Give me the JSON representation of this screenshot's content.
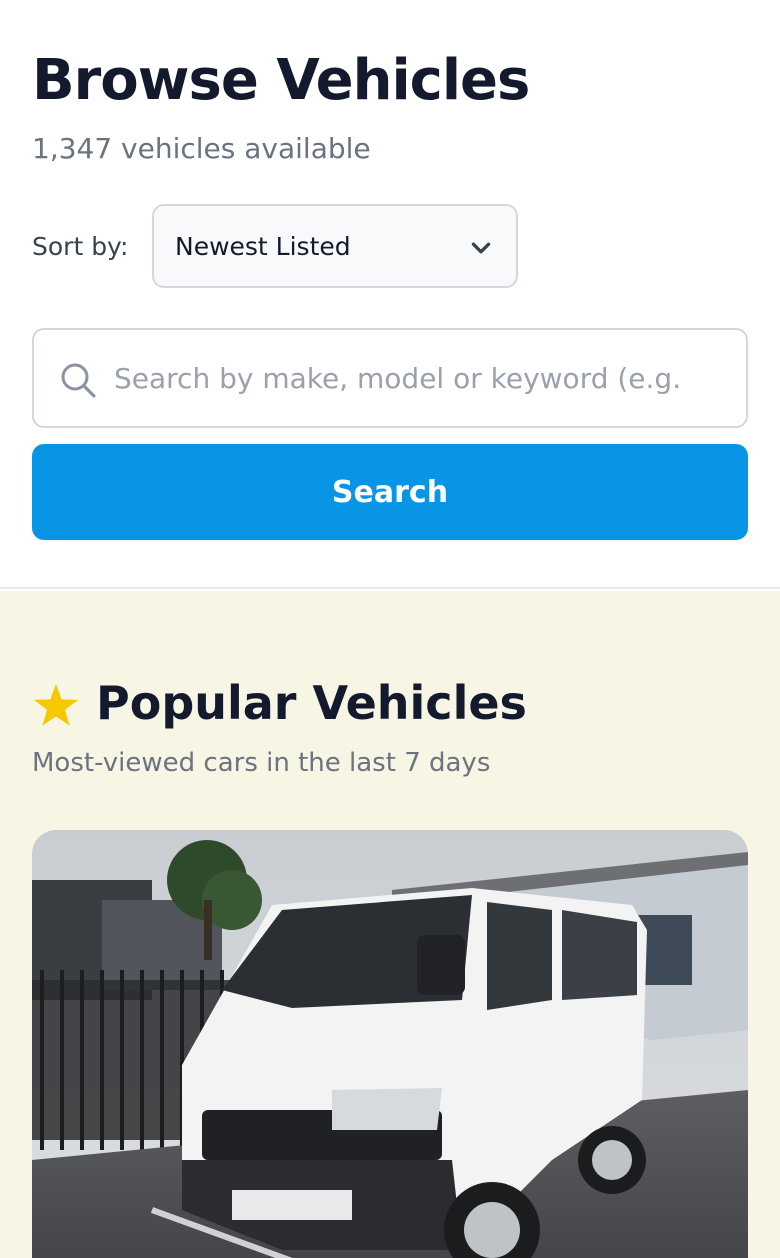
{
  "header": {
    "title": "Browse Vehicles",
    "count_text": "1,347 vehicles available"
  },
  "sort": {
    "label": "Sort by:",
    "selected": "Newest Listed",
    "icon": "chevron-down-icon"
  },
  "search": {
    "placeholder": "Search by make, model or keyword (e.g.",
    "value": "",
    "icon": "search-icon",
    "button_label": "Search"
  },
  "popular": {
    "icon": "star-icon",
    "title": "Popular Vehicles",
    "subtitle": "Most-viewed cars in the last 7 days",
    "cards": [
      {
        "photo": "white-van-photo"
      }
    ]
  },
  "colors": {
    "accent": "#0895e6",
    "star": "#f5c800",
    "popular_background": "#f7f5e3",
    "title_text": "#141a2e",
    "muted_text": "#6b7280"
  }
}
